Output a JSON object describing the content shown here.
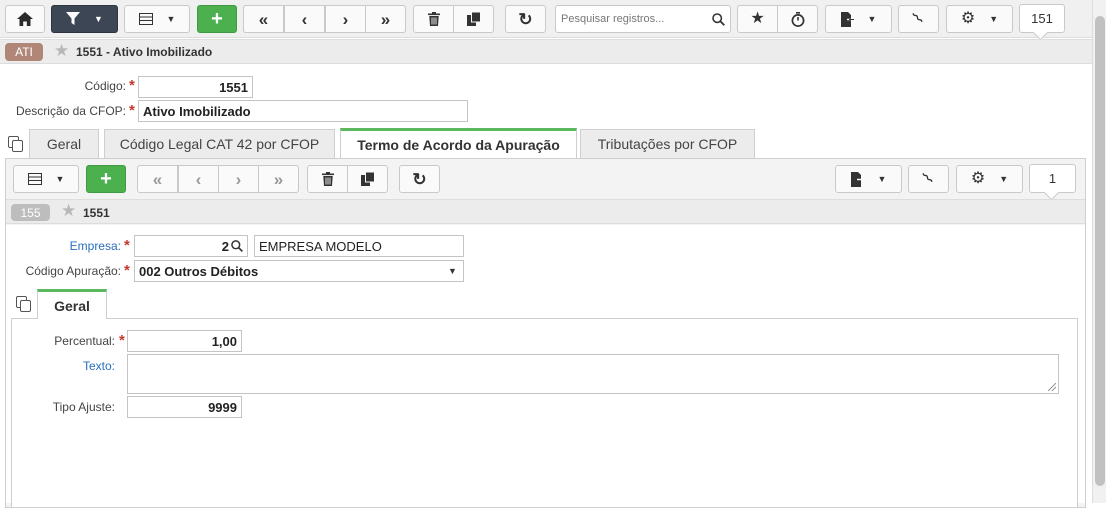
{
  "toolbar": {
    "search_placeholder": "Pesquisar registros...",
    "record_count": "151",
    "add_label": "+"
  },
  "record": {
    "badge": "ATI",
    "title": "1551 - Ativo Imobilizado",
    "badge_color": "#b08678"
  },
  "form": {
    "codigo_label": "Código:",
    "codigo_value": "1551",
    "descricao_label": "Descrição da CFOP:",
    "descricao_value": "Ativo Imobilizado"
  },
  "tabs": [
    {
      "label": "Geral"
    },
    {
      "label": "Código Legal CAT 42 por CFOP"
    },
    {
      "label": "Termo de Acordo da Apuração"
    },
    {
      "label": "Tributações por CFOP"
    }
  ],
  "subtoolbar": {
    "add_label": "+",
    "record_count": "1"
  },
  "subrecord": {
    "badge": "155",
    "title": "1551",
    "badge_color": "#bdbdbd"
  },
  "subform": {
    "empresa_label": "Empresa:",
    "empresa_code": "2",
    "empresa_name": "EMPRESA MODELO",
    "codigo_apuracao_label": "Código Apuração:",
    "codigo_apuracao_value": "002 Outros Débitos"
  },
  "subtabs": [
    {
      "label": "Geral"
    }
  ],
  "detail": {
    "percentual_label": "Percentual:",
    "percentual_value": "1,00",
    "texto_label": "Texto:",
    "texto_value": "",
    "tipo_ajuste_label": "Tipo Ajuste:",
    "tipo_ajuste_value": "9999"
  },
  "colors": {
    "accent_green": "#4cb04f",
    "tab_active_border": "#5cb85c",
    "dark_button": "#3d4654",
    "required": "#c0392b",
    "link_label": "#2a6ebb"
  }
}
